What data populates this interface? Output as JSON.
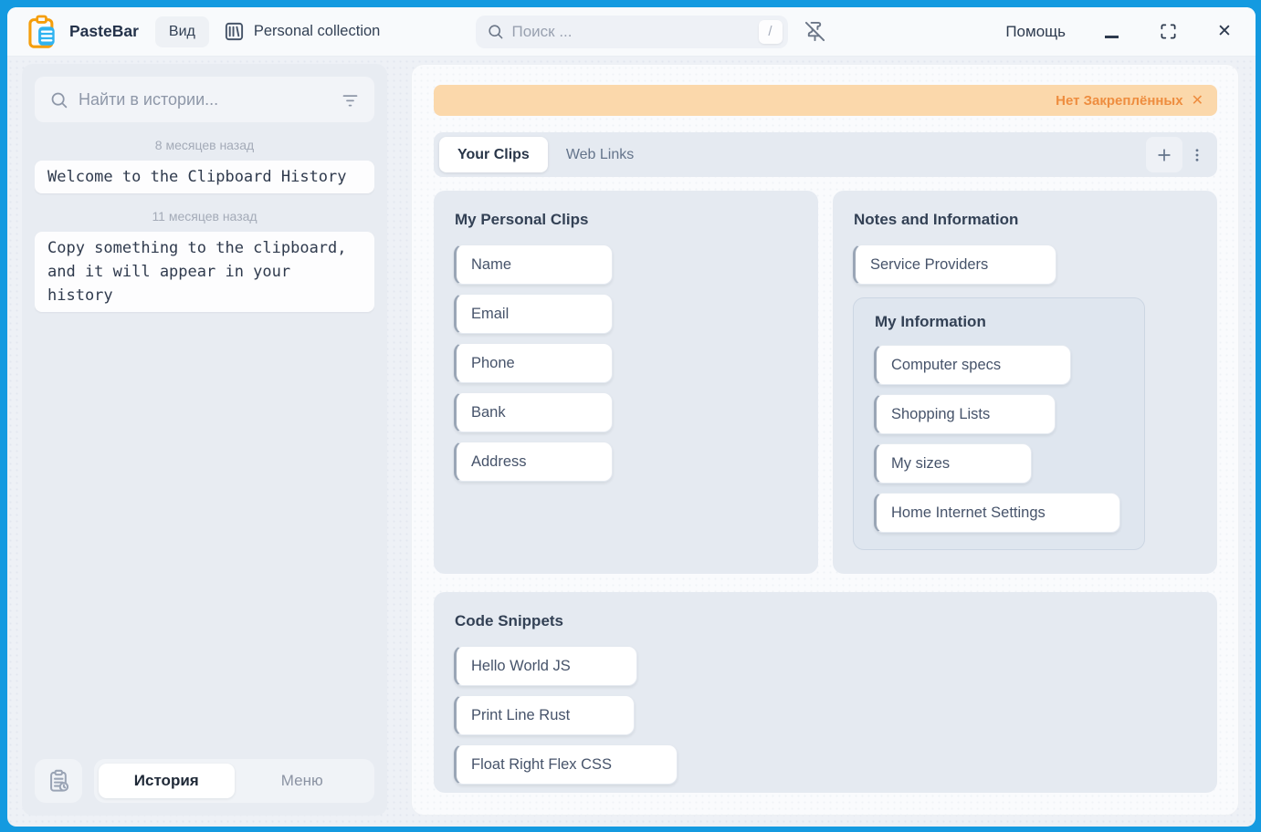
{
  "app": {
    "name": "PasteBar"
  },
  "colors": {
    "window_border_blue": "#149ae0",
    "banner_bg": "#fbd8ab",
    "banner_text": "#ee8d3f",
    "logo_orange": "#f59e0b",
    "logo_blue": "#2fb3f0"
  },
  "topbar": {
    "view_button_label": "Вид",
    "collection_label": "Personal collection",
    "search_placeholder": "Поиск ...",
    "search_shortcut_key": "/",
    "help_label": "Помощь",
    "close_icon": "✕"
  },
  "sidebar": {
    "search_placeholder": "Найти в истории...",
    "history_groups": [
      {
        "time_label": "8 месяцев назад",
        "items": [
          {
            "text": "Welcome to the Clipboard History"
          }
        ]
      },
      {
        "time_label": "11 месяцев назад",
        "items": [
          {
            "text": "Copy something to the clipboard, and it will appear in your history"
          }
        ]
      }
    ],
    "footer_tabs": [
      {
        "label": "История",
        "active": true
      },
      {
        "label": "Меню",
        "active": false
      }
    ]
  },
  "main": {
    "pinned_banner": {
      "label": "Нет Закреплённых",
      "close_icon": "✕"
    },
    "clip_tabs": [
      {
        "label": "Your Clips",
        "active": true
      },
      {
        "label": "Web Links",
        "active": false
      }
    ],
    "plus_icon": "+",
    "menu_dots_icon": "⋮",
    "boards": [
      {
        "title": "My Personal Clips",
        "clips": [
          "Name",
          "Email",
          "Phone",
          "Bank",
          "Address"
        ]
      },
      {
        "title": "Notes and Information",
        "clips": [
          "Service Providers"
        ],
        "subboard": {
          "title": "My Information",
          "clips": [
            "Computer specs",
            "Shopping Lists",
            "My sizes",
            "Home Internet Settings"
          ]
        }
      },
      {
        "title": "Code Snippets",
        "clips": [
          "Hello World JS",
          "Print Line Rust",
          "Float Right Flex CSS"
        ]
      }
    ]
  }
}
